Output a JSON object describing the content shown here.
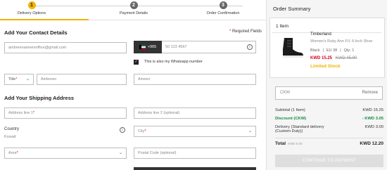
{
  "steps": [
    {
      "number": "1",
      "label": "Delivery Options"
    },
    {
      "number": "2",
      "label": "Payment Details"
    },
    {
      "number": "3",
      "label": "Order Confirmation"
    }
  ],
  "contact": {
    "title": "Add Your Contact Details",
    "required_note": "Required Fields",
    "email_value": "ambreenameenoffice@gmail.com",
    "phone_code": "+965",
    "phone_value": "50 123 4567",
    "whatsapp_label": "This is also my Whatsapp number",
    "title_select": "Title",
    "first_name": "Ambreen",
    "last_name": "Ameen"
  },
  "shipping": {
    "title": "Add Your Shipping Address",
    "address1_placeholder": "Address line 1",
    "address2_placeholder": "Address line 2 (optional)",
    "country_label": "Country",
    "country_value": "Kuwait",
    "city_placeholder": "City",
    "area_placeholder": "Area",
    "postal_placeholder": "Postal Code (optional)"
  },
  "summary": {
    "title": "Order Summary",
    "item_count": "1 Item",
    "product": {
      "brand": "Timberland",
      "name": "Women's Ruby Ann F/L 6-Inch Shoe",
      "color": "Black",
      "size": "EU 38",
      "qty": "Qty: 1",
      "price_now": "KWD 15.25",
      "price_was": "KWD 45.90",
      "stock": "Limited Stock"
    },
    "coupon_code": "CKW",
    "coupon_remove": "Remove",
    "subtotal_label": "Subtotal (1 Item)",
    "subtotal_value": "KWD 15.25",
    "discount_label": "Discount (CKW)",
    "discount_value": "- KWD 3.05",
    "delivery_label": "Delivery (Standard delivery",
    "delivery_label2": "(Custom Duty))",
    "delivery_value": "KWD 3.00",
    "total_label": "Total",
    "total_sub": "KWD 0.00",
    "total_value": "KWD 12.20",
    "continue_label": "CONTINUE TO PAYMENT"
  },
  "colors": {
    "accent": "#f2b300",
    "discount": "#138b43",
    "sale": "#d6001c"
  }
}
